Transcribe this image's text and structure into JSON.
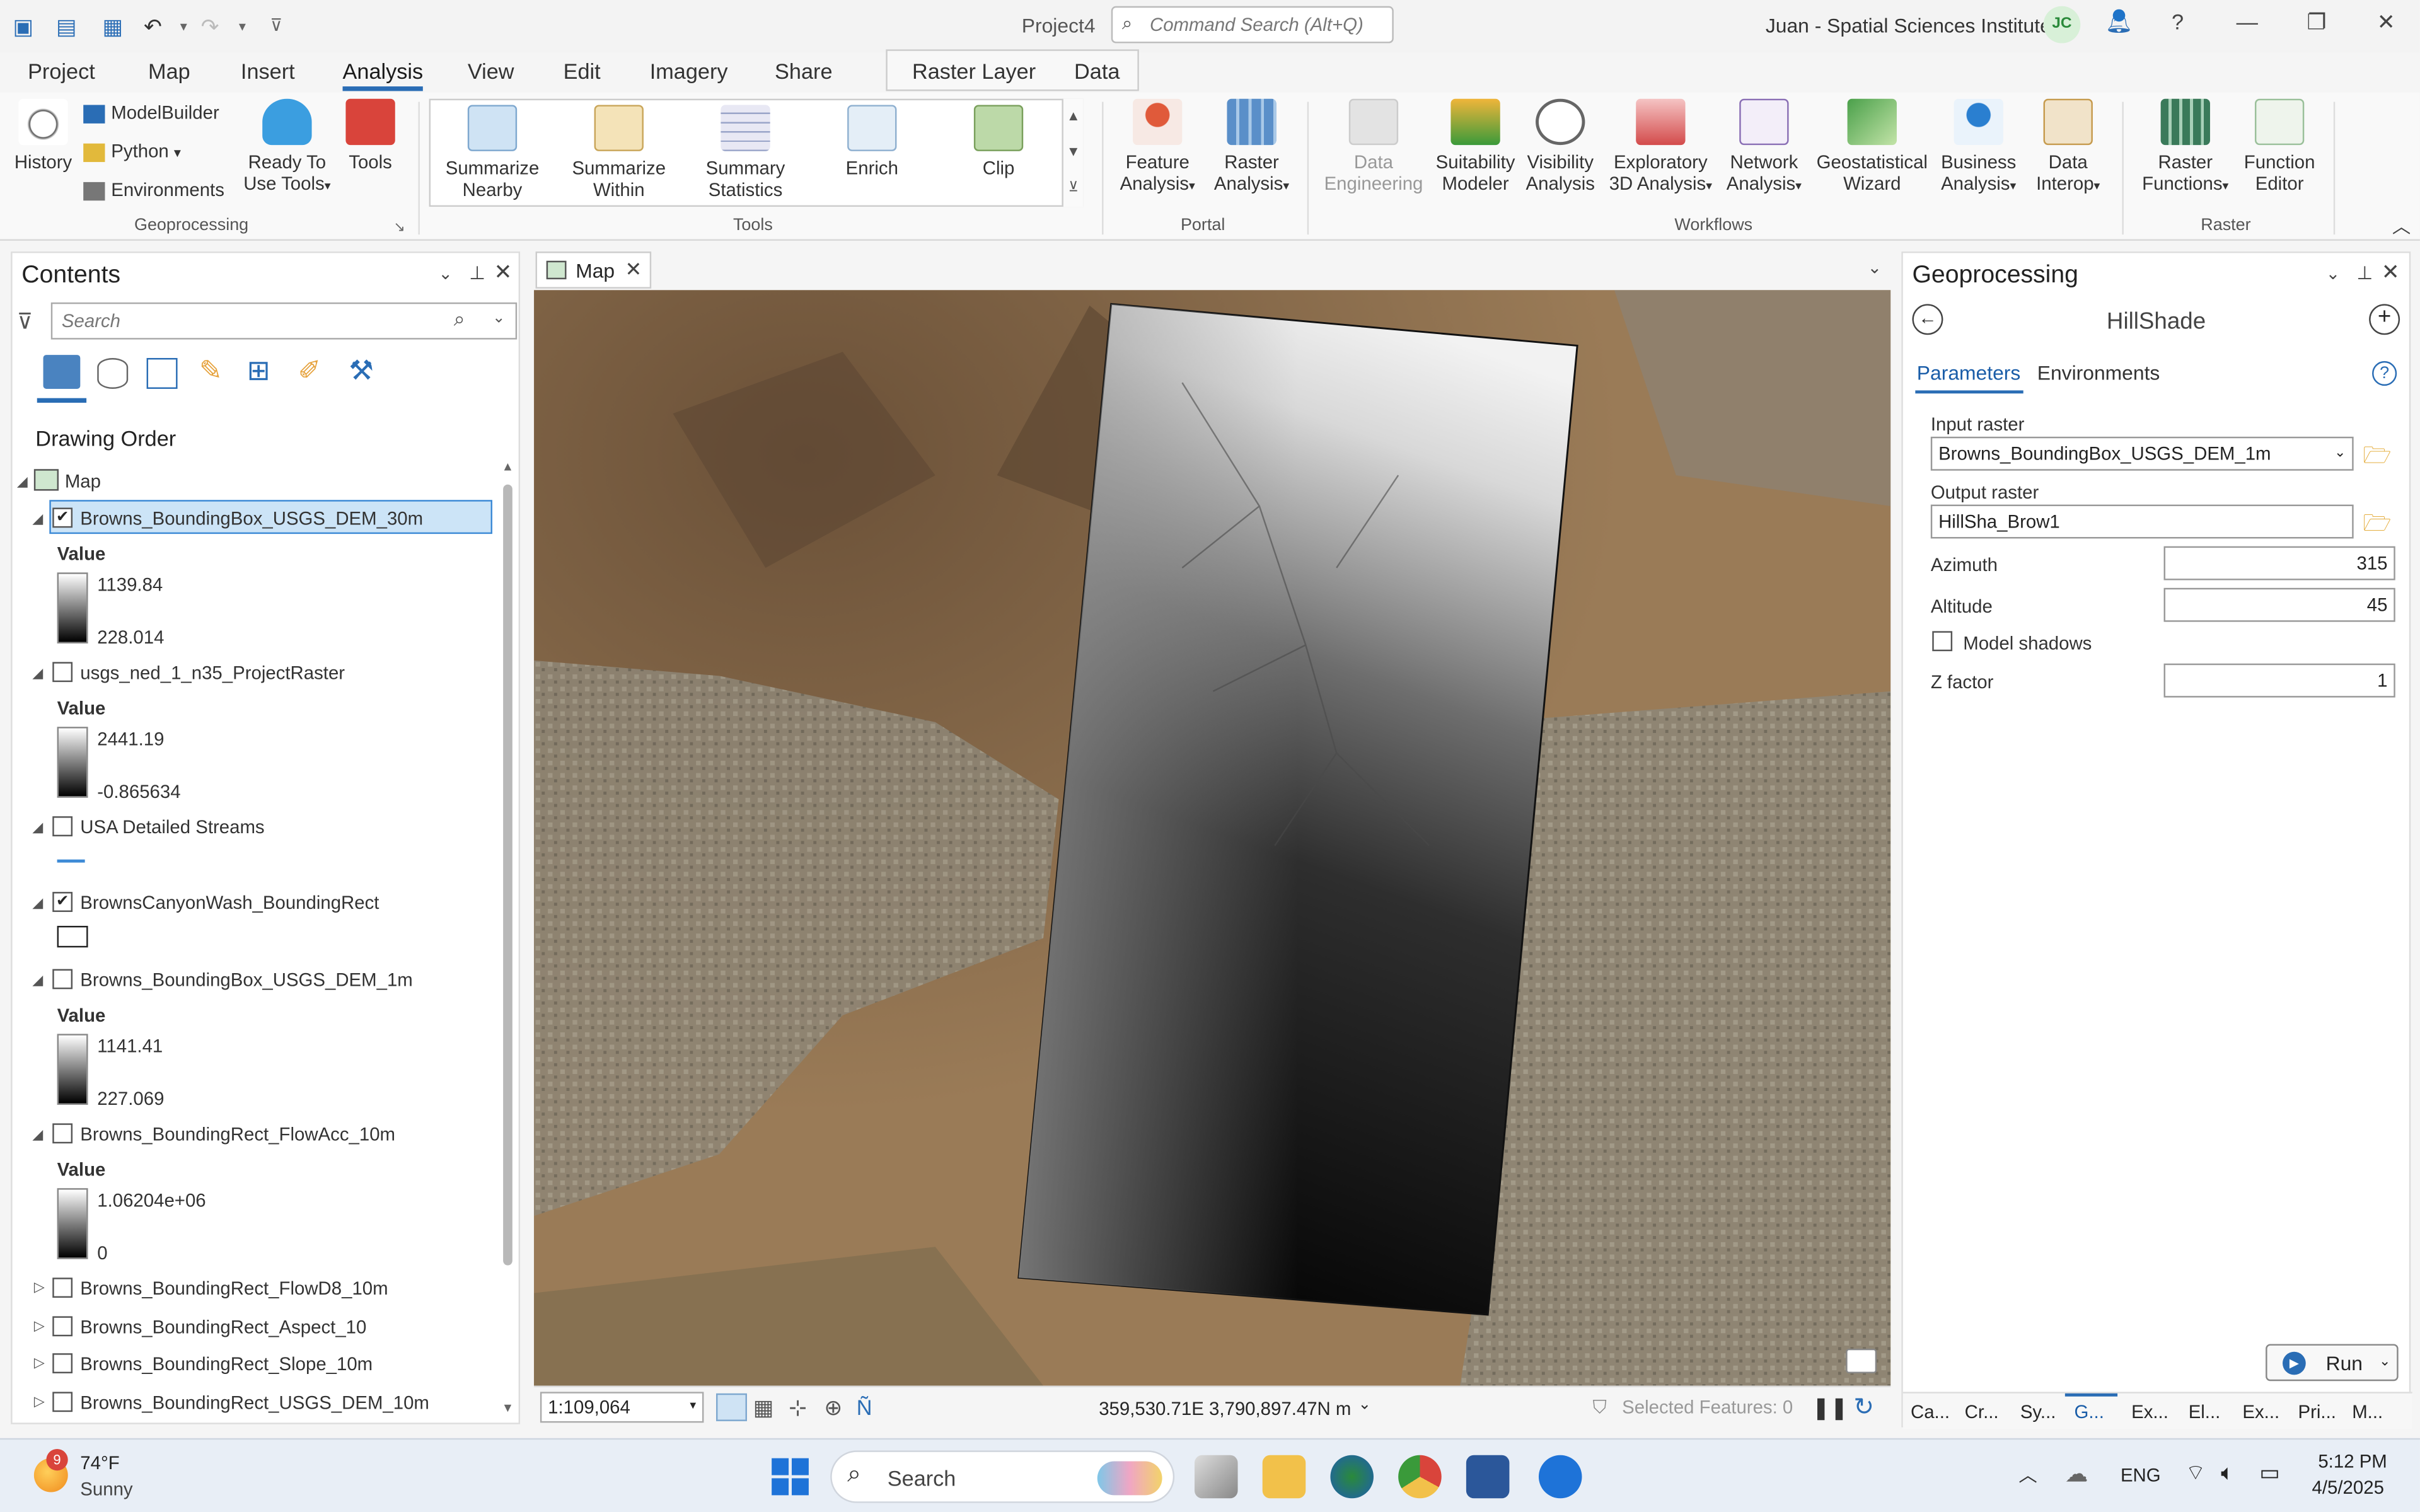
{
  "title_bar": {
    "project": "Project4",
    "command_search_placeholder": "Command Search (Alt+Q)",
    "user": "Juan - Spatial Sciences Institute",
    "avatar": "JC"
  },
  "menu_tabs": [
    "Project",
    "Map",
    "Insert",
    "Analysis",
    "View",
    "Edit",
    "Imagery",
    "Share"
  ],
  "contextual_tabs": {
    "group": "Raster Layer",
    "tab": "Data"
  },
  "ribbon": {
    "geoprocessing": {
      "group": "Geoprocessing",
      "history": "History",
      "modelbuilder": "ModelBuilder",
      "python": "Python",
      "environments": "Environments",
      "ready_tools_1": "Ready To",
      "ready_tools_2": "Use Tools",
      "tools": "Tools"
    },
    "tools": {
      "group": "Tools",
      "items": [
        [
          "Summarize",
          "Nearby"
        ],
        [
          "Summarize",
          "Within"
        ],
        [
          "Summary",
          "Statistics"
        ],
        [
          "Enrich",
          ""
        ],
        [
          "Clip",
          ""
        ]
      ]
    },
    "portal": {
      "group": "Portal",
      "items": [
        [
          "Feature",
          "Analysis"
        ],
        [
          "Raster",
          "Analysis"
        ]
      ]
    },
    "workflows": {
      "group": "Workflows",
      "items": [
        [
          "Data",
          "Engineering"
        ],
        [
          "Suitability",
          "Modeler"
        ],
        [
          "Visibility",
          "Analysis"
        ],
        [
          "Exploratory",
          "3D Analysis"
        ],
        [
          "Network",
          "Analysis"
        ],
        [
          "Geostatistical",
          "Wizard"
        ],
        [
          "Business",
          "Analysis"
        ],
        [
          "Data",
          "Interop"
        ]
      ]
    },
    "raster": {
      "group": "Raster",
      "items": [
        [
          "Raster",
          "Functions"
        ],
        [
          "Function",
          "Editor"
        ]
      ]
    }
  },
  "contents": {
    "title": "Contents",
    "search_placeholder": "Search",
    "drawing_order": "Drawing Order",
    "map": "Map",
    "layers": [
      {
        "name": "Browns_BoundingBox_USGS_DEM_30m",
        "checked": true,
        "value_label": "Value",
        "high": "1139.84",
        "low": "228.014"
      },
      {
        "name": "usgs_ned_1_n35_ProjectRaster",
        "checked": false,
        "value_label": "Value",
        "high": "2441.19",
        "low": "-0.865634"
      },
      {
        "name": "USA Detailed Streams",
        "checked": false
      },
      {
        "name": "BrownsCanyonWash_BoundingRect",
        "checked": true
      },
      {
        "name": "Browns_BoundingBox_USGS_DEM_1m",
        "checked": false,
        "value_label": "Value",
        "high": "1141.41",
        "low": "227.069"
      },
      {
        "name": "Browns_BoundingRect_FlowAcc_10m",
        "checked": false,
        "value_label": "Value",
        "high": "1.06204e+06",
        "low": "0"
      },
      {
        "name": "Browns_BoundingRect_FlowD8_10m",
        "checked": false
      },
      {
        "name": "Browns_BoundingRect_Aspect_10",
        "checked": false
      },
      {
        "name": "Browns_BoundingRect_Slope_10m",
        "checked": false
      },
      {
        "name": "Browns_BoundingRect_USGS_DEM_10m",
        "checked": false
      }
    ]
  },
  "map": {
    "tab": "Map",
    "scale": "1:109,064",
    "coordinates": "359,530.71E 3,790,897.47N m",
    "selected_features": "Selected Features: 0"
  },
  "geoprocessing": {
    "title": "Geoprocessing",
    "tool": "HillShade",
    "tab_parameters": "Parameters",
    "tab_environments": "Environments",
    "input_raster_label": "Input raster",
    "input_raster": "Browns_BoundingBox_USGS_DEM_1m",
    "output_raster_label": "Output raster",
    "output_raster": "HillSha_Brow1",
    "azimuth_label": "Azimuth",
    "azimuth": "315",
    "altitude_label": "Altitude",
    "altitude": "45",
    "model_shadows_label": "Model shadows",
    "z_factor_label": "Z factor",
    "z_factor": "1",
    "run": "Run",
    "bottom_tabs": [
      "Ca...",
      "Cr...",
      "Sy...",
      "G...",
      "Ex...",
      "El...",
      "Ex...",
      "Pri...",
      "M..."
    ]
  },
  "taskbar": {
    "temp": "74°F",
    "weather": "Sunny",
    "badge": "9",
    "search": "Search",
    "lang": "ENG",
    "time": "5:12 PM",
    "date": "4/5/2025"
  }
}
